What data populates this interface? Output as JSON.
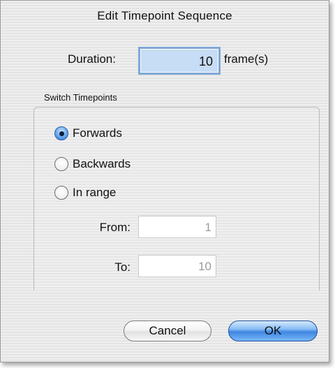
{
  "dialog": {
    "title": "Edit Timepoint Sequence"
  },
  "duration": {
    "label": "Duration:",
    "value": "10",
    "unit": "frame(s)"
  },
  "switch_group": {
    "label": "Switch Timepoints",
    "options": [
      {
        "label": "Forwards",
        "selected": true
      },
      {
        "label": "Backwards",
        "selected": false
      },
      {
        "label": "In range",
        "selected": false
      }
    ],
    "from_label": "From:",
    "from_value": "1",
    "to_label": "To:",
    "to_value": "10"
  },
  "buttons": {
    "cancel": "Cancel",
    "ok": "OK"
  },
  "colors": {
    "accent": "#3f86e2",
    "field_focus": "#c7dcf5"
  }
}
